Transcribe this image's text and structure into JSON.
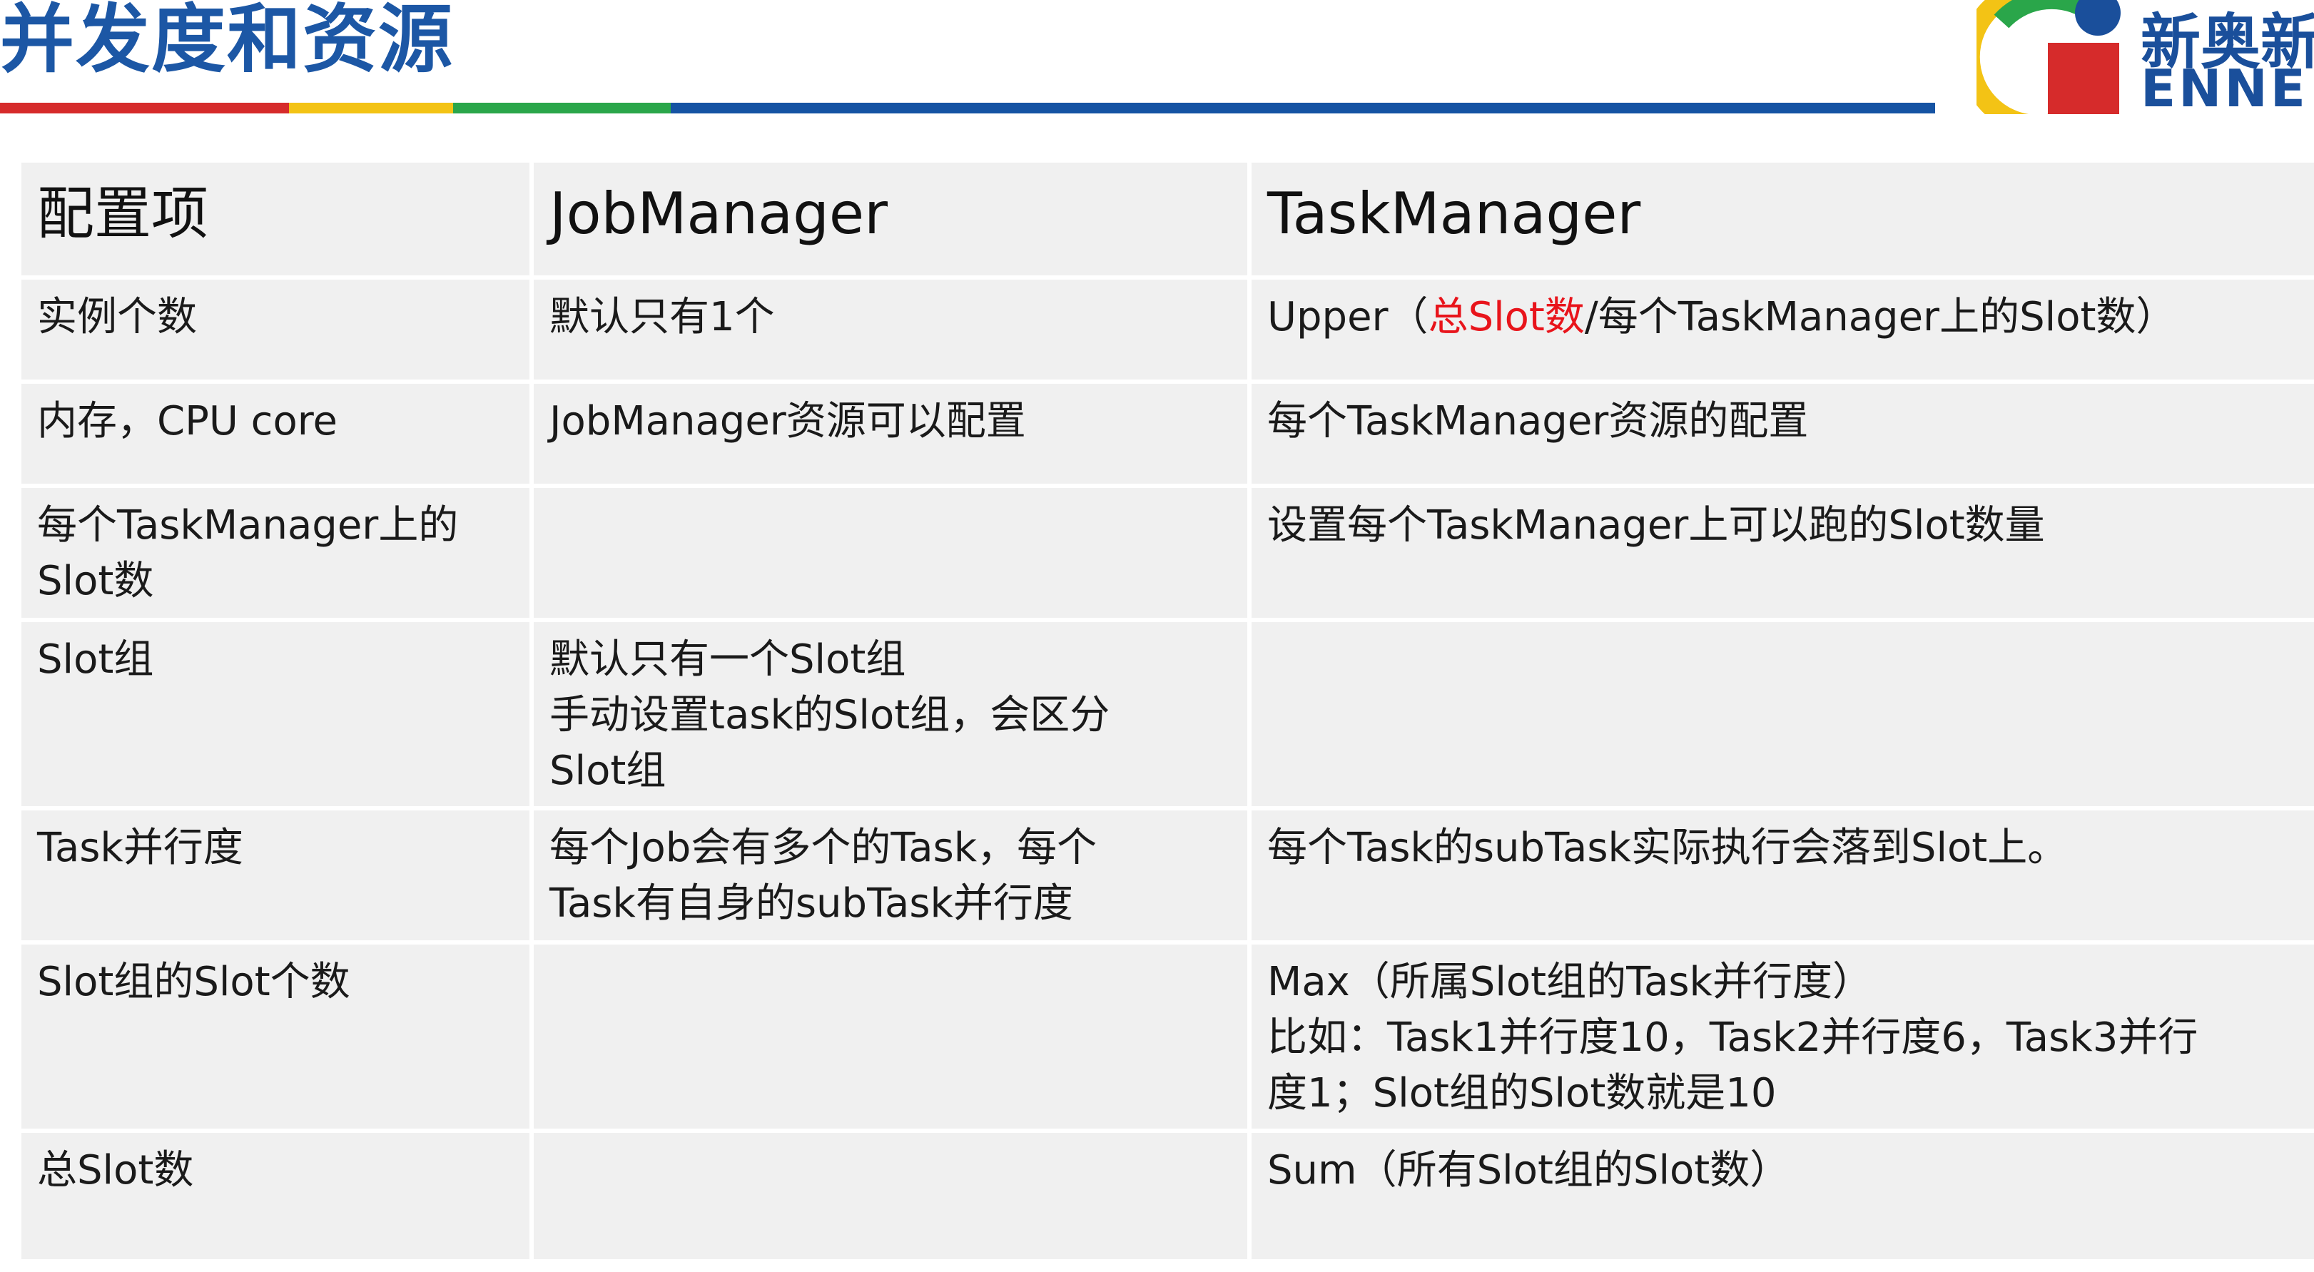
{
  "slide": {
    "title": "并发度和资源",
    "logo": {
      "cn": "新奥新",
      "en": "ENNE"
    },
    "colors": {
      "title": "#1c57a5",
      "accent_red": "#e8141b",
      "bar_red": "#d62b2b",
      "bar_yellow": "#f3c315",
      "bar_green": "#2aa64a",
      "bar_blue": "#1553a3"
    }
  },
  "table": {
    "headers": [
      "配置项",
      "JobManager",
      "TaskManager"
    ],
    "rows": [
      {
        "item": "实例个数",
        "jobmanager": [
          "默认只有1个"
        ],
        "taskmanager": {
          "prefix": "Upper（",
          "highlight": "总Slot数",
          "suffix": "/每个TaskManager上的Slot数）"
        }
      },
      {
        "item": "内存，CPU core",
        "jobmanager": [
          "JobManager资源可以配置"
        ],
        "taskmanager": [
          "每个TaskManager资源的配置"
        ]
      },
      {
        "item_lines": [
          "每个TaskManager上的",
          "Slot数"
        ],
        "jobmanager": [],
        "taskmanager": [
          "设置每个TaskManager上可以跑的Slot数量"
        ]
      },
      {
        "item": "Slot组",
        "jobmanager": [
          "默认只有一个Slot组",
          "手动设置task的Slot组，会区分",
          "Slot组"
        ],
        "taskmanager": []
      },
      {
        "item": "Task并行度",
        "jobmanager": [
          "每个Job会有多个的Task，每个",
          "Task有自身的subTask并行度"
        ],
        "taskmanager": [
          "每个Task的subTask实际执行会落到Slot上。"
        ]
      },
      {
        "item": "Slot组的Slot个数",
        "jobmanager": [],
        "taskmanager": [
          "Max（所属Slot组的Task并行度）",
          "比如：Task1并行度10，Task2并行度6，Task3并行",
          "度1；Slot组的Slot数就是10"
        ]
      },
      {
        "item": "总Slot数",
        "jobmanager": [],
        "taskmanager": [
          "Sum（所有Slot组的Slot数）"
        ]
      }
    ]
  }
}
